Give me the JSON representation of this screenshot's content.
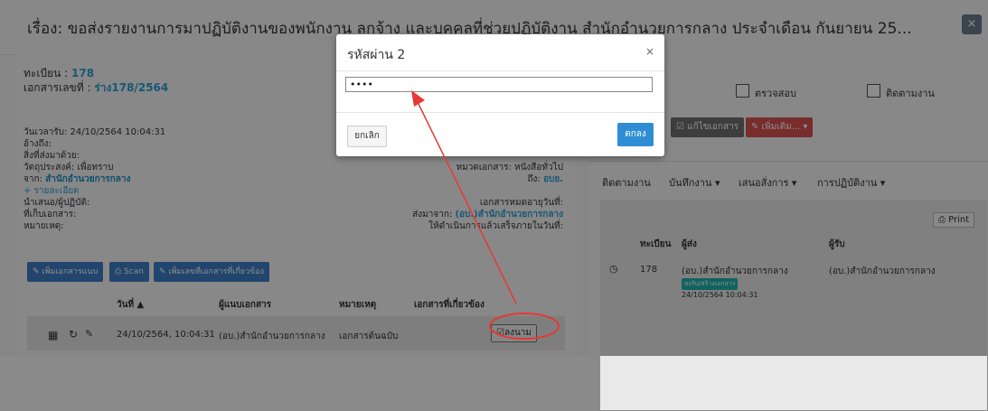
{
  "title": {
    "text": "เรื่อง: ขอส่งรายงานการมาปฏิบัติงานของพนักงาน ลูกจ้าง และบุคคลที่ช่วยปฏิบัติงาน สำนักอำนวยการกลาง ประจำเดือน กันยายน 25...",
    "close": "×"
  },
  "left": {
    "reg_label": "ทะเบียน :",
    "reg_value": "178",
    "docno_label": "เอกสารเลขที่ :",
    "docno_value": "ร่าง178/2564",
    "received": "วันเวลารับ: 24/10/2564 10:04:31",
    "ref": "อ้างถึง:",
    "attach": "สิ่งที่ส่งมาด้วย:",
    "purpose": "วัตถุประสงค์: เพื่อทราบ",
    "from_label": "จาก:",
    "from_value": "สำนักอำนวยการกลาง",
    "details_link": "+ รายละเอียด",
    "proposer": "นำเสนอ/ผู้ปฏิบัติ:",
    "storage": "ที่เก็บเอกสาร:",
    "remark": "หมายเหตุ:",
    "category": "หมวดเอกสาร: หนังสือทั่วไป",
    "to_label": "ถึง:",
    "to_value": "อบย.",
    "expire": "เอกสารหมดอายุวันที่:",
    "sent_from_label": "ส่งมาจาก:",
    "sent_from_value": "(อบ.)สำนักอำนวยการกลาง",
    "complete": "ให้ดำเนินการแล้วเสร็จภายในวันที่:",
    "btn_attach": "✎ เพิ่มเอกสารแนบ",
    "btn_scan": "⎙ Scan",
    "btn_related": "✎ เพิ่มเลขที่เอกสารที่เกี่ยวข้อง",
    "table_headers": [
      "วันที่ ▲",
      "ผู้แนบเอกสาร",
      "หมายเหตุ",
      "เอกสารที่เกี่ยวข้อง"
    ],
    "row": {
      "date": "24/10/2564, 10:04:31",
      "by": "(อบ.)สำนักอำนวยการกลาง",
      "note": "เอกสารต้นฉบับ",
      "sign": "☑ลงนาม"
    }
  },
  "right": {
    "check_label": "ตรวจสอบ",
    "follow_label": "ติดตามงาน",
    "btn_edit": "☑ แก้ไขเอกสาร",
    "btn_more": "✎ เพิ่มเติม... ▾",
    "tabs": [
      "ติดตามงาน",
      "บันทึกงาน ▾",
      "เสนอสั่งการ ▾",
      "การปฏิบัติงาน ▾"
    ],
    "print": "⎙ Print",
    "headers": [
      "ทะเบียน",
      "ผู้ส่ง",
      "ผู้รับ"
    ],
    "row": {
      "no": "178",
      "sender": "(อบ.)สำนักอำนวยการกลาง",
      "receiver": "(อบ.)สำนักอำนวยการกลาง",
      "badge": "ลงรับ/สร้างเอกสาร",
      "time": "24/10/2564 10:04:31"
    }
  },
  "modal": {
    "title": "รหัสผ่าน 2",
    "close": "×",
    "password": "••••",
    "cancel": "ยกเลิก",
    "ok": "ตกลง"
  },
  "colors": {
    "accent_blue": "#2a9fd6",
    "annotation_red": "#e53935",
    "badge_teal": "#1fb5ad",
    "danger": "#d9534f"
  }
}
